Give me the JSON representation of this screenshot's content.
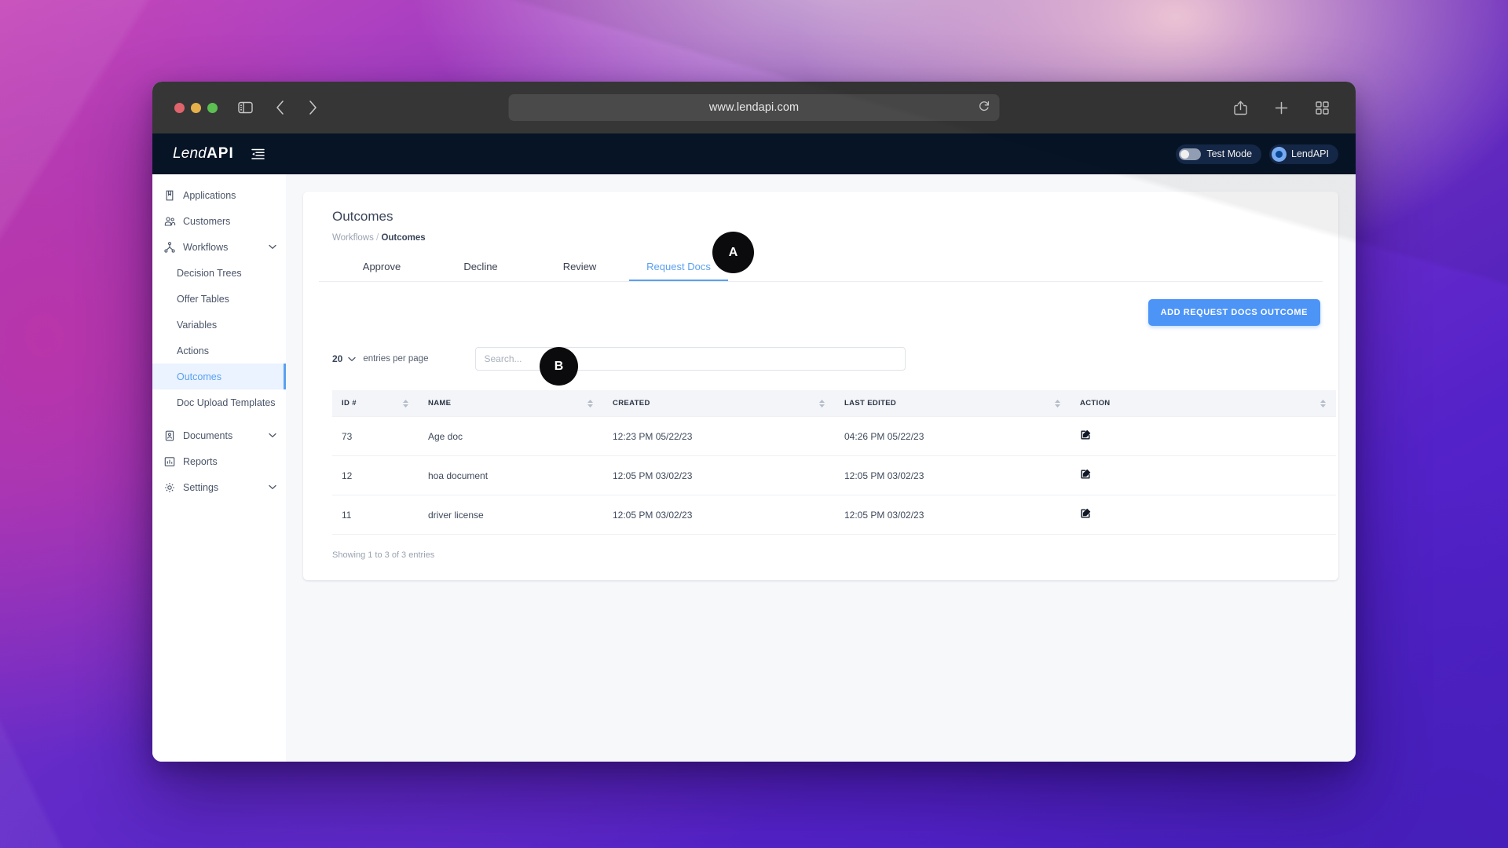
{
  "browser": {
    "url": "www.lendapi.com",
    "traffic_lights": [
      "close-red",
      "minimize-yellow",
      "maximize-green"
    ],
    "icons": {
      "sidebar_toggle": "sidebar-toggle-icon",
      "back": "back-arrow-icon",
      "forward": "forward-arrow-icon",
      "reload": "reload-icon",
      "share": "share-icon",
      "new_tab": "plus-icon",
      "tab_overview": "grid-icon"
    }
  },
  "app_header": {
    "brand_lend": "Lend",
    "brand_api": "API",
    "menu_icon": "hamburger-collapse-icon",
    "test_mode_label": "Test Mode",
    "test_mode_on": false,
    "account_label": "LendAPI"
  },
  "sidebar": {
    "items": [
      {
        "label": "Applications",
        "icon": "applications-icon",
        "level": 0,
        "expandable": false,
        "active": false
      },
      {
        "label": "Customers",
        "icon": "customers-icon",
        "level": 0,
        "expandable": false,
        "active": false
      },
      {
        "label": "Workflows",
        "icon": "workflows-icon",
        "level": 0,
        "expandable": true,
        "active": false
      },
      {
        "label": "Decision Trees",
        "icon": "",
        "level": 1,
        "expandable": false,
        "active": false
      },
      {
        "label": "Offer Tables",
        "icon": "",
        "level": 1,
        "expandable": false,
        "active": false
      },
      {
        "label": "Variables",
        "icon": "",
        "level": 1,
        "expandable": false,
        "active": false
      },
      {
        "label": "Actions",
        "icon": "",
        "level": 1,
        "expandable": false,
        "active": false
      },
      {
        "label": "Outcomes",
        "icon": "",
        "level": 1,
        "expandable": false,
        "active": true
      },
      {
        "label": "Doc Upload Templates",
        "icon": "",
        "level": 1,
        "expandable": false,
        "active": false
      },
      {
        "label": "Documents",
        "icon": "documents-icon",
        "level": 0,
        "expandable": true,
        "active": false
      },
      {
        "label": "Reports",
        "icon": "reports-icon",
        "level": 0,
        "expandable": false,
        "active": false
      },
      {
        "label": "Settings",
        "icon": "settings-gear-icon",
        "level": 0,
        "expandable": true,
        "active": false
      }
    ]
  },
  "main": {
    "page_title": "Outcomes",
    "breadcrumb": {
      "parent": "Workflows",
      "separator": "/",
      "current": "Outcomes"
    },
    "tabs": [
      {
        "label": "Approve",
        "active": false
      },
      {
        "label": "Decline",
        "active": false
      },
      {
        "label": "Review",
        "active": false
      },
      {
        "label": "Request Docs",
        "active": true
      }
    ],
    "add_button_label": "ADD REQUEST DOCS OUTCOME",
    "entries_per_page_value": "20",
    "entries_per_page_label": "entries per page",
    "search_placeholder": "Search...",
    "search_value": "",
    "table": {
      "columns": [
        "ID #",
        "NAME",
        "CREATED",
        "LAST EDITED",
        "ACTION"
      ],
      "rows": [
        {
          "id": "73",
          "name": "Age doc",
          "created": "12:23 PM 05/22/23",
          "last_edited": "04:26 PM 05/22/23",
          "action": "edit-icon"
        },
        {
          "id": "12",
          "name": "hoa document",
          "created": "12:05 PM 03/02/23",
          "last_edited": "12:05 PM 03/02/23",
          "action": "edit-icon"
        },
        {
          "id": "11",
          "name": "driver license",
          "created": "12:05 PM 03/02/23",
          "last_edited": "12:05 PM 03/02/23",
          "action": "edit-icon"
        }
      ]
    },
    "showing_text": "Showing 1 to 3 of 3 entries"
  },
  "annotations": [
    {
      "id": "A",
      "target": "request-docs-tab"
    },
    {
      "id": "B",
      "target": "table-header"
    }
  ],
  "colors": {
    "accent_blue": "#5aa0f0",
    "button_blue": "#4d94f7",
    "header_navy": "#061426",
    "toolbar_gray": "#363636",
    "active_nav_bg": "#eaf3ff"
  }
}
